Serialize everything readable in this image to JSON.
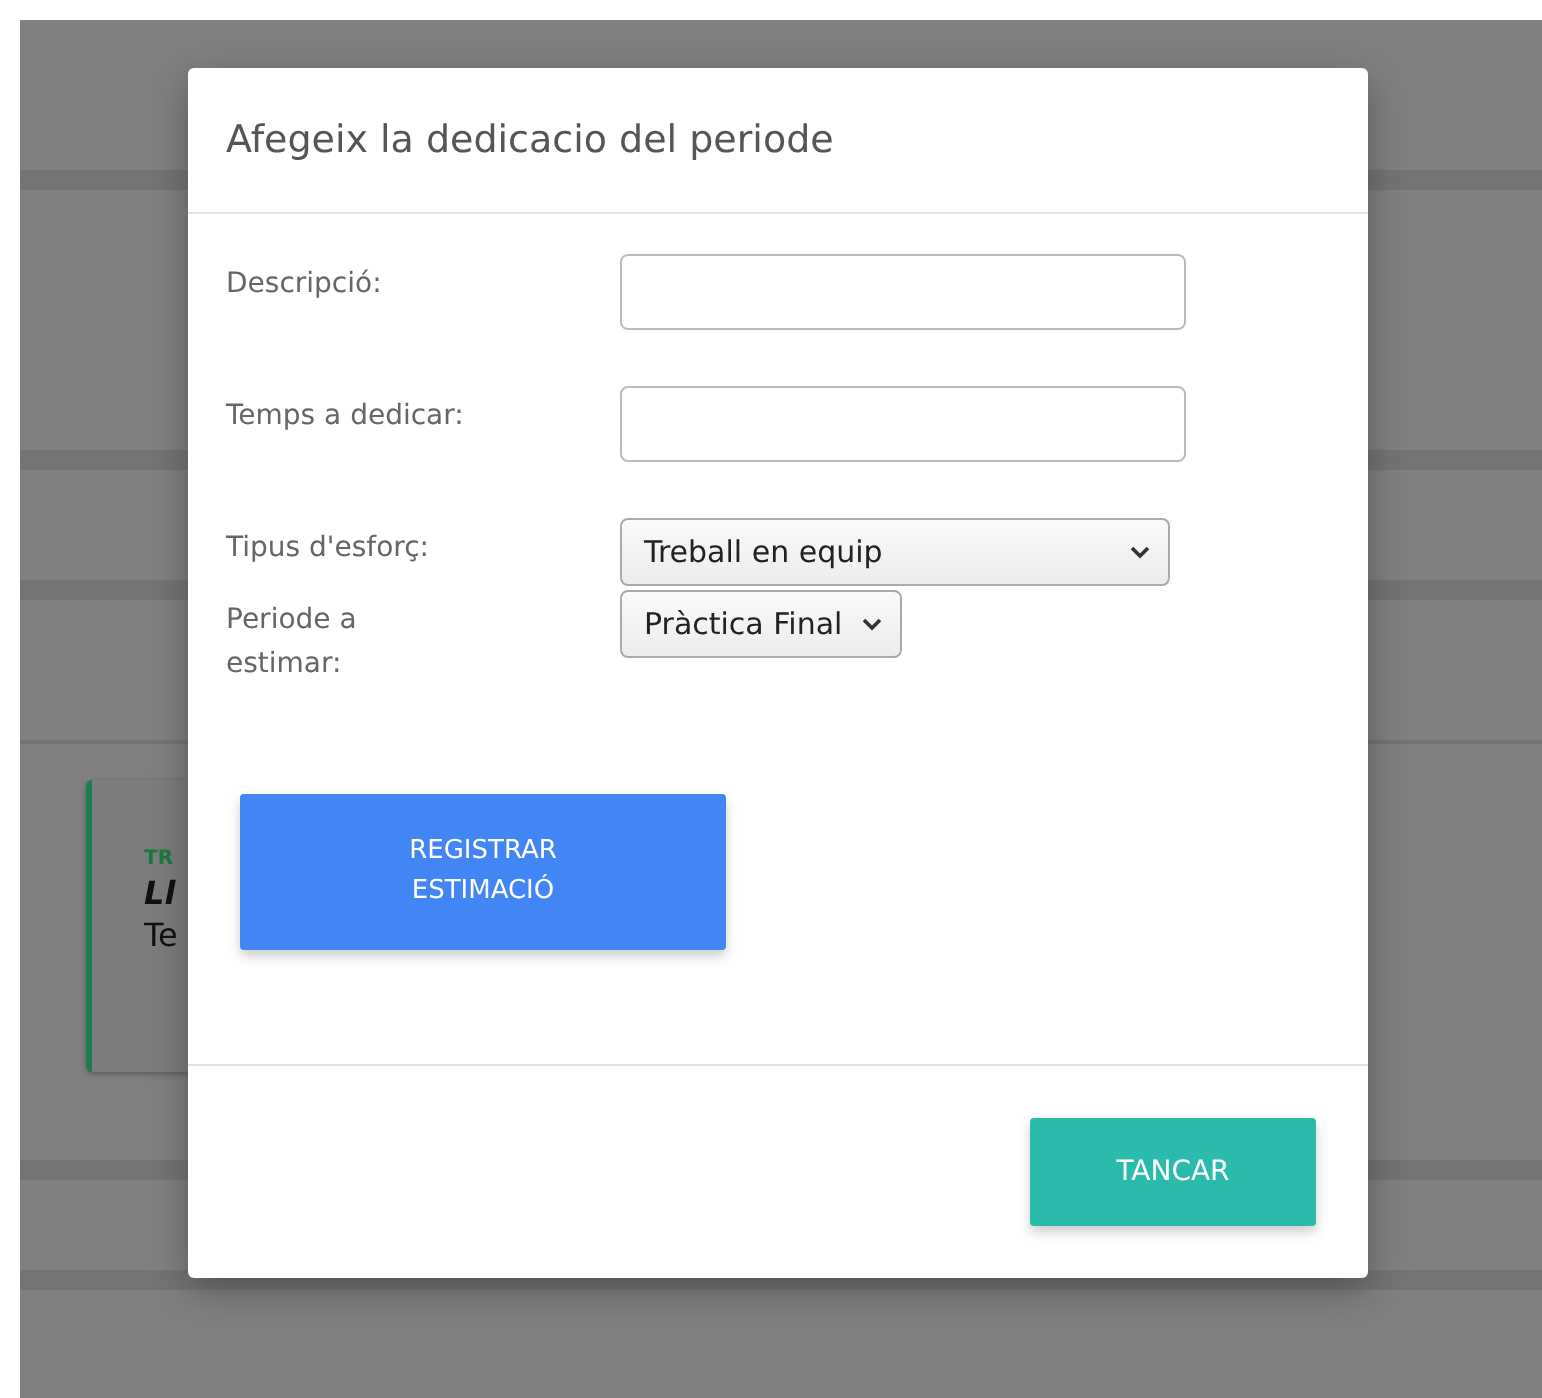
{
  "background_card": {
    "tag": "TR",
    "title": "Ll",
    "text": "Te"
  },
  "modal": {
    "title": "Afegeix la dedicacio del periode",
    "fields": [
      {
        "kind": "text",
        "label": "Descripció:"
      },
      {
        "kind": "text",
        "label": "Temps a dedicar:"
      },
      {
        "kind": "select",
        "label": "Tipus d'esforç:",
        "value": "Treball en equip",
        "wide": true
      },
      {
        "kind": "select",
        "label": "Periode a estimar:",
        "value": "Pràctica Final",
        "wide": false
      }
    ],
    "submit_button": "REGISTRAR ESTIMACIÓ",
    "close_button": "TANCAR"
  }
}
